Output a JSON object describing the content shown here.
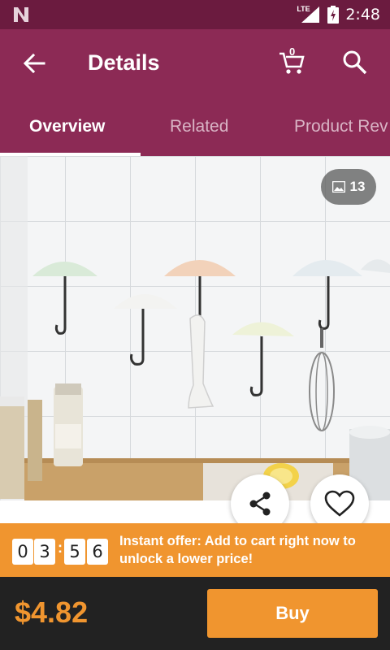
{
  "status_bar": {
    "time": "2:48",
    "network": "LTE"
  },
  "app_bar": {
    "title": "Details",
    "cart_count": "0"
  },
  "tabs": [
    {
      "label": "Overview",
      "active": true
    },
    {
      "label": "Related",
      "active": false
    },
    {
      "label": "Product Rev",
      "active": false
    }
  ],
  "gallery": {
    "photo_count": "13"
  },
  "offer": {
    "timer_digits": [
      "0",
      "3",
      "5",
      "6"
    ],
    "text": "Instant offer: Add to cart right now to unlock a lower price!"
  },
  "footer": {
    "price": "$4.82",
    "buy_label": "Buy"
  },
  "colors": {
    "status_bar": "#6b1b3f",
    "app_bar": "#8c2a55",
    "accent": "#f0952f",
    "footer": "#222222"
  },
  "icons": [
    "n-logo-icon",
    "lte-signal-icon",
    "battery-icon",
    "back-arrow-icon",
    "cart-icon",
    "search-icon",
    "image-icon",
    "share-icon",
    "heart-icon"
  ]
}
